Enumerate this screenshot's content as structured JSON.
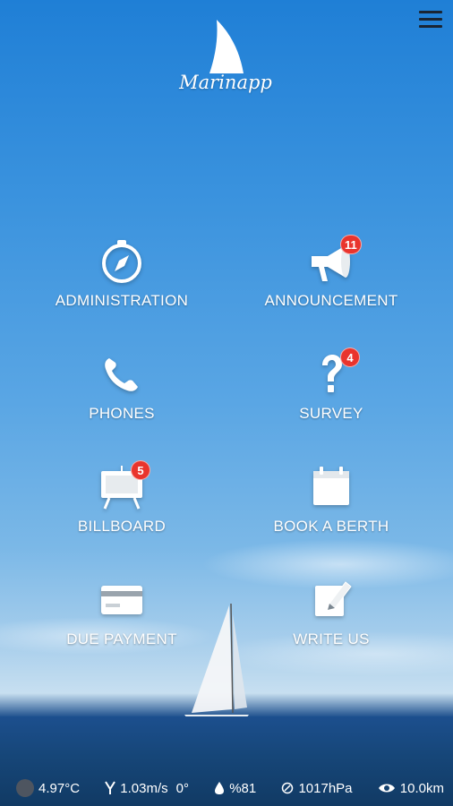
{
  "app": {
    "name": "Marinapp"
  },
  "menu": {
    "icon": "hamburger-menu-icon"
  },
  "tiles": [
    {
      "label": "ADMINISTRATION",
      "icon": "compass-icon",
      "badge": ""
    },
    {
      "label": "ANNOUNCEMENT",
      "icon": "megaphone-icon",
      "badge": "11"
    },
    {
      "label": "PHONES",
      "icon": "phone-icon",
      "badge": ""
    },
    {
      "label": "SURVEY",
      "icon": "question-mark-icon",
      "badge": "4"
    },
    {
      "label": "BILLBOARD",
      "icon": "easel-board-icon",
      "badge": "5"
    },
    {
      "label": "BOOK A BERTH",
      "icon": "calendar-icon",
      "badge": ""
    },
    {
      "label": "DUE PAYMENT",
      "icon": "credit-card-icon",
      "badge": ""
    },
    {
      "label": "WRITE US",
      "icon": "pencil-note-icon",
      "badge": ""
    }
  ],
  "weather": {
    "temperature": "4.97°C",
    "wind_speed": "1.03m/s",
    "wind_direction": "0°",
    "humidity": "%81",
    "pressure": "1017hPa",
    "visibility": "10.0km"
  },
  "colors": {
    "badge": "#e9342d",
    "sky_top": "#1f7fd6",
    "sea": "#164678"
  }
}
